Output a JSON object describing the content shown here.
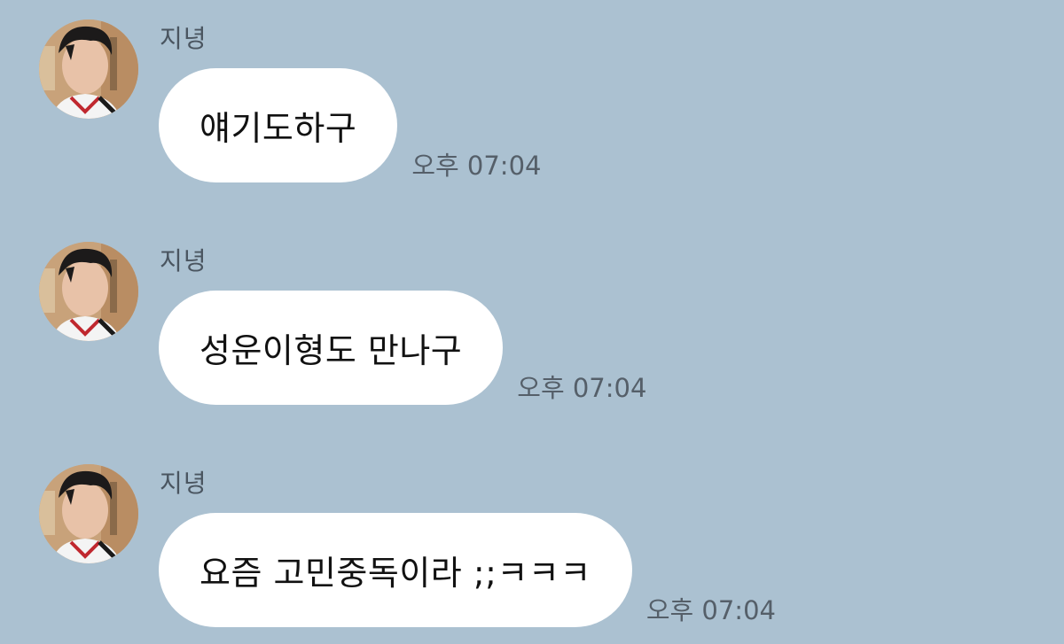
{
  "messages": [
    {
      "sender": "지녕",
      "text": "얘기도하구",
      "time": "오후 07:04"
    },
    {
      "sender": "지녕",
      "text": "성운이형도 만나구",
      "time": "오후 07:04"
    },
    {
      "sender": "지녕",
      "text": "요즘 고민중독이라 ;;ㅋㅋㅋ",
      "time": "오후 07:04"
    }
  ],
  "colors": {
    "background": "#abc1d1",
    "bubble": "#ffffff",
    "timestamp": "#555f69"
  },
  "icons": {
    "avatar": "profile-photo"
  }
}
